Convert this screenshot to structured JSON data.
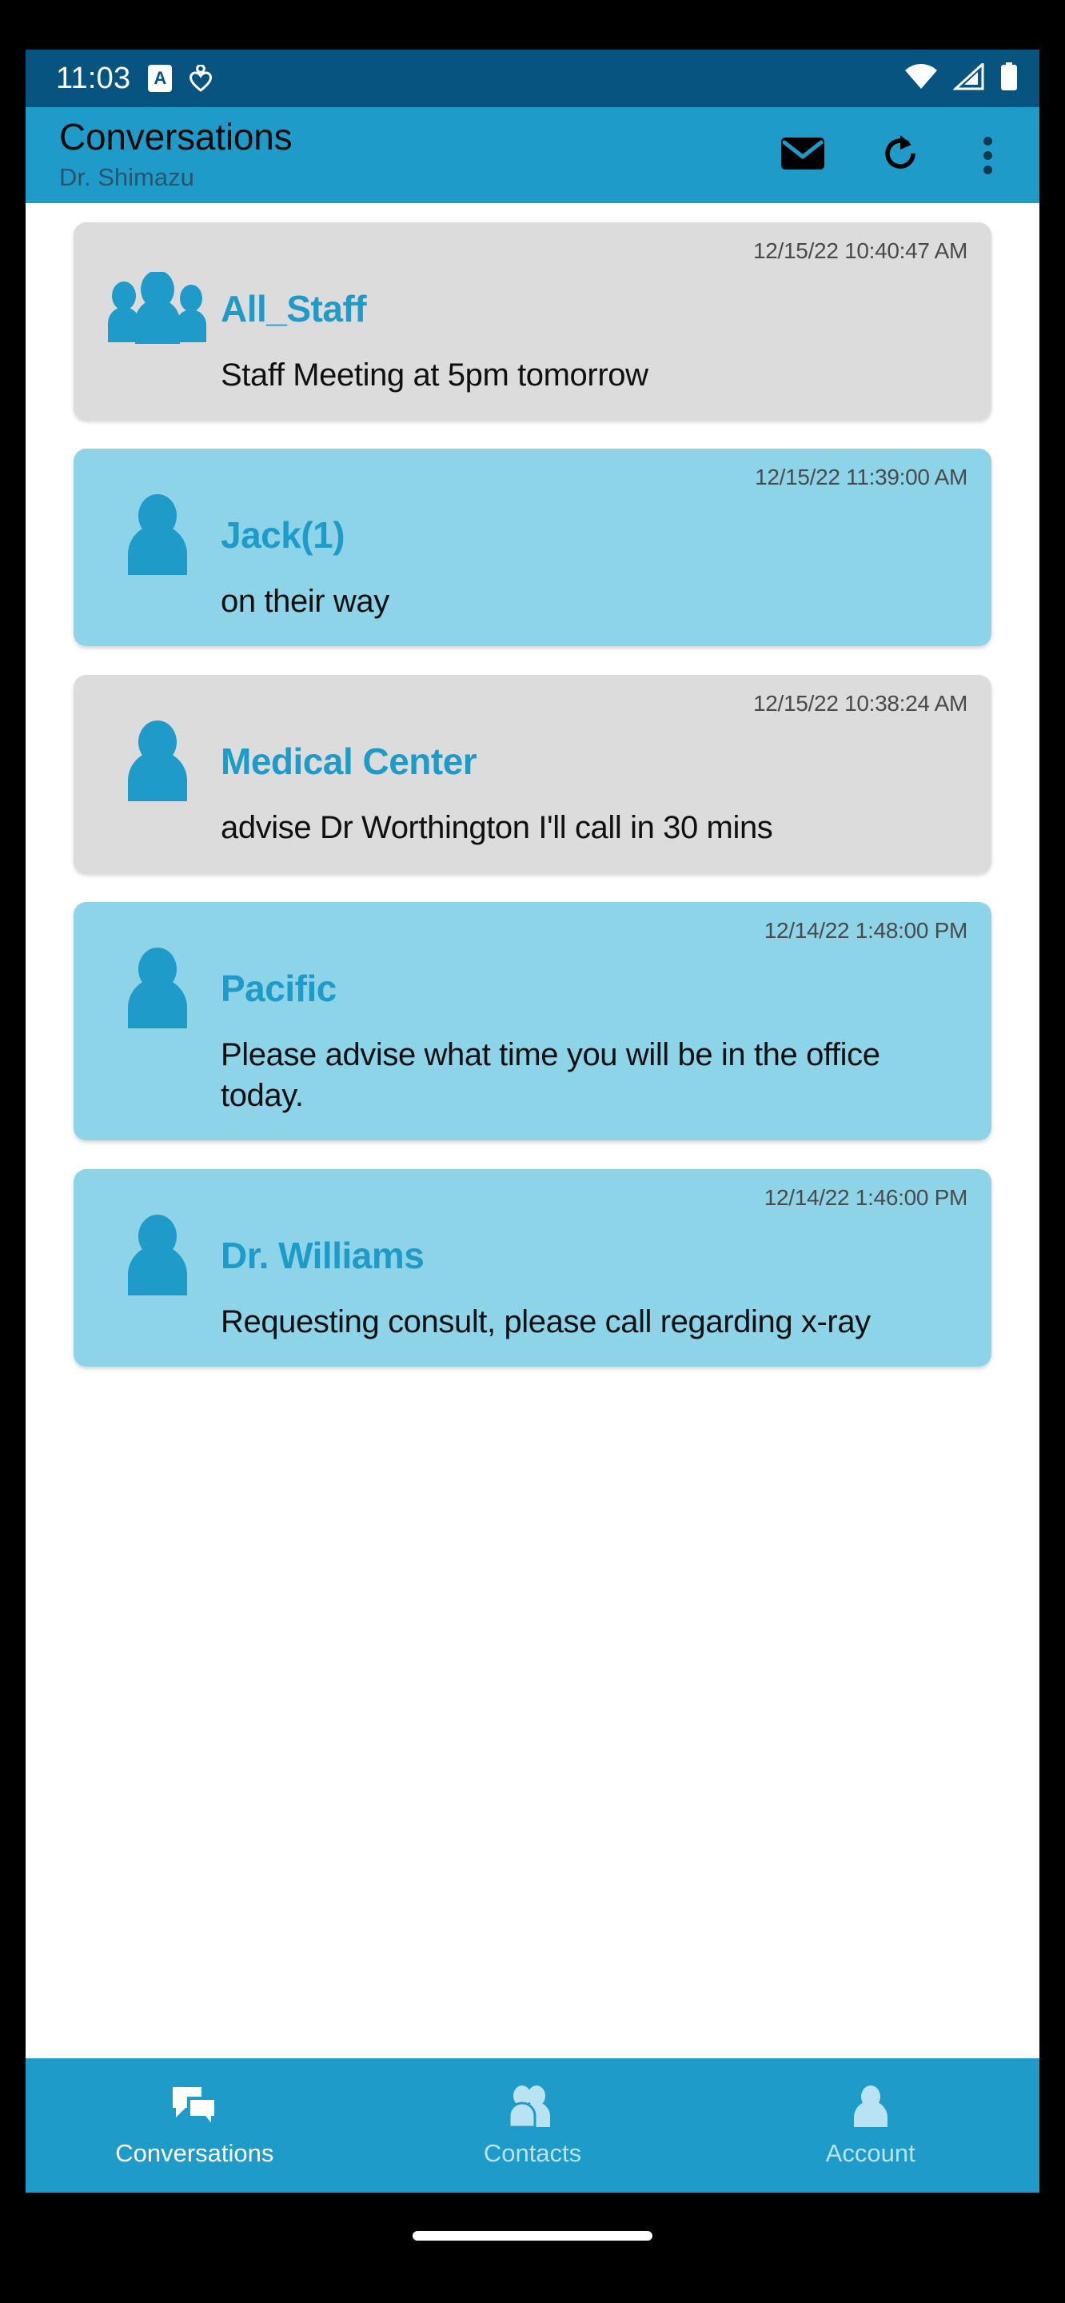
{
  "theme": {
    "status_bar_bg": "#075480",
    "app_bar_bg": "#1f9bc9",
    "accent": "#1f9bc9",
    "card_read_bg": "#dcdcdc",
    "card_unread_bg": "#8ed4e9",
    "screen_bg": "#ffffff"
  },
  "status_bar": {
    "clock": "11:03",
    "app_badge_letter": "A",
    "left_icons": [
      "app-badge-icon",
      "heart-icon"
    ],
    "right_icons": [
      "wifi-icon",
      "cellular-signal-icon",
      "battery-icon"
    ]
  },
  "app_bar": {
    "title": "Conversations",
    "subtitle": "Dr. Shimazu",
    "actions": [
      {
        "name": "compose-mail-button",
        "icon": "mail-icon"
      },
      {
        "name": "refresh-button",
        "icon": "refresh-icon"
      },
      {
        "name": "overflow-menu-button",
        "icon": "more-vertical-icon"
      }
    ]
  },
  "conversations": [
    {
      "name": "All_Staff",
      "timestamp": "12/15/22 10:40:47 AM",
      "message": "Staff Meeting at 5pm tomorrow",
      "avatar": "group-icon",
      "state": "read"
    },
    {
      "name": "Jack(1)",
      "timestamp": "12/15/22 11:39:00 AM",
      "message": "on their way",
      "avatar": "person-icon",
      "state": "unread"
    },
    {
      "name": "Medical Center",
      "timestamp": "12/15/22 10:38:24 AM",
      "message": "advise Dr  Worthington I'll call in 30 mins",
      "avatar": "person-icon",
      "state": "read"
    },
    {
      "name": "Pacific",
      "timestamp": "12/14/22 1:48:00 PM",
      "message": "Please advise what time you will be in the office today.",
      "avatar": "person-icon",
      "state": "unread"
    },
    {
      "name": "Dr. Williams",
      "timestamp": "12/14/22 1:46:00 PM",
      "message": "Requesting consult, please call regarding x-ray",
      "avatar": "person-icon",
      "state": "unread"
    }
  ],
  "bottom_nav": {
    "items": [
      {
        "label": "Conversations",
        "icon": "chat-bubble-icon",
        "active": true
      },
      {
        "label": "Contacts",
        "icon": "contacts-icon",
        "active": false
      },
      {
        "label": "Account",
        "icon": "account-person-icon",
        "active": false
      }
    ]
  }
}
